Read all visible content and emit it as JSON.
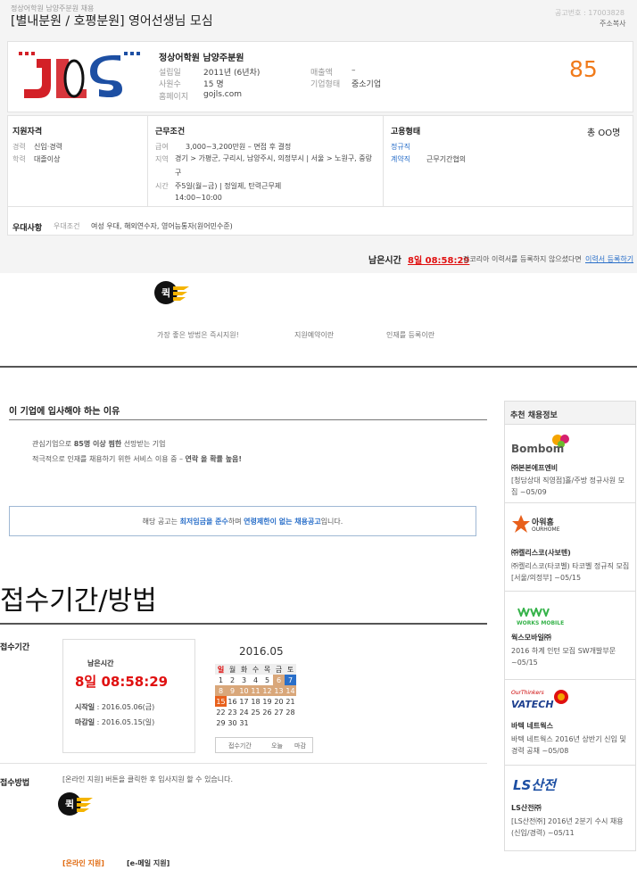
{
  "header": {
    "subtitle": "정상어학원 남양주분원 채용",
    "title": "[별내분원 / 호평분원] 영어선생님 모심",
    "notice_no": "공고번호 : 17003828",
    "copy_addr": "주소복사"
  },
  "company": {
    "name": "정상어학원 남양주분원",
    "established_label": "설립일",
    "established": "2011년 (6년차)",
    "employees_label": "사원수",
    "employees": "15 명",
    "homepage_label": "홈페이지",
    "homepage": "gojls.com",
    "sales_label": "매출액",
    "sales": "–",
    "type_label": "기업형태",
    "type": "중소기업",
    "score": "85",
    "score_color": "#f07a1a"
  },
  "conditions": {
    "qual_title": "지원자격",
    "career_label": "경력",
    "career": "신입·경력",
    "edu_label": "학력",
    "edu": "대졸이상",
    "work_title": "근무조건",
    "pay_label": "급여",
    "pay": "3,000~3,200만원 – 면접 후 결정",
    "region_label": "지역",
    "region": "경기 > 가평군, 구리시, 남양주시, 의정부시 | 서울 > 노원구, 중랑구",
    "time_label": "시간",
    "time": "주5일(월~금) | 정일제, 탄력근무제",
    "time2": "14:00~10:00",
    "emp_title": "고용형태",
    "headcount": "총 OO명",
    "emp_type1": "정규직",
    "emp_type2": "계약직",
    "emp_type2_desc": "근무기간협의",
    "pref_title": "우대사항",
    "pref_label": "우대조건",
    "pref": "여성 우대, 해외연수자, 영어능통자(원어민수준)"
  },
  "remaining": {
    "label": "남은시간",
    "time": "8일 08:58:29",
    "note": "잡코리아 이력서를 등록하지 않으셨다면",
    "link": "이력서 등록하기"
  },
  "quick": {
    "icon_text": "퀵",
    "items": [
      "가장 좋은 방법은 즉시지원!",
      "지원예약이란",
      "인재를 등록이란"
    ]
  },
  "reason": {
    "title": "이 기업에 입사해야 하는 이유",
    "line1_a": "관심기업으로",
    "line1_b": "85명 이상 찜한",
    "line1_c": "선망받는 기업",
    "line2_a": "적극적으로 인재를 채용하기 위한 서비스 이용 중 –",
    "line2_b": "연락 올 확률 높음!"
  },
  "notice": {
    "a": "해당 공고는",
    "b": "최저임금을 준수",
    "c": "하며",
    "d": "연령제한이 없는 채용공고",
    "e": "입니다."
  },
  "apply": {
    "section_title": "접수기간/방법",
    "period_label": "접수기간",
    "remain_label": "남은시간",
    "remain_time": "8일 08:58:29",
    "start_label": "시작일",
    "start": "2016.05.06(금)",
    "end_label": "마감일",
    "end": "2016.05.15(일)",
    "method_label": "접수방법",
    "method_text": "[온라인 지원] 버튼을 클릭한 후 입사지원 할 수 있습니다.",
    "btn_online": "[온라인 지원]",
    "btn_email": "[e-메일 지원]"
  },
  "calendar": {
    "title": "2016.05",
    "days": [
      "일",
      "월",
      "화",
      "수",
      "목",
      "금",
      "토"
    ],
    "weeks": [
      [
        "1",
        "2",
        "3",
        "4",
        "5",
        "6",
        "7"
      ],
      [
        "8",
        "9",
        "10",
        "11",
        "12",
        "13",
        "14"
      ],
      [
        "15",
        "16",
        "17",
        "18",
        "19",
        "20",
        "21"
      ],
      [
        "22",
        "23",
        "24",
        "25",
        "26",
        "27",
        "28"
      ],
      [
        "29",
        "30",
        "31",
        "",
        "",
        "",
        ""
      ]
    ],
    "legend": [
      "접수기간",
      "오늘",
      "마감"
    ]
  },
  "sidebar": {
    "title": "추천 채용정보",
    "items": [
      {
        "logo": "Bombom",
        "company": "㈜본본에프엔비",
        "desc": "[청담상대 직영점]홀/주방 정규사원 모집 ~05/09"
      },
      {
        "logo": "아워홈",
        "logo_sub": "OURHOME",
        "company": "㈜켈리스코(사보텐)",
        "desc": "㈜켈리스코(타코벨) 타코벨 정규직 모집 [서울/의정부] ~05/15"
      },
      {
        "logo": "WORKS MOBILE",
        "company": "웍스모바일㈜",
        "desc": "2016 하계 인턴 모집 SW개발부문 ~05/15"
      },
      {
        "logo": "VATECH",
        "logo_sub": "OurThinkers",
        "company": "바텍 네트웍스",
        "desc": "바텍 네트웍스 2016년 상반기 신입 및 경력 공채 ~05/08"
      },
      {
        "logo": "LS산전",
        "company": "LS산전㈜",
        "desc": "[LS산전㈜] 2016년 2분기 수시 채용(신입/경력) ~05/11"
      }
    ]
  }
}
